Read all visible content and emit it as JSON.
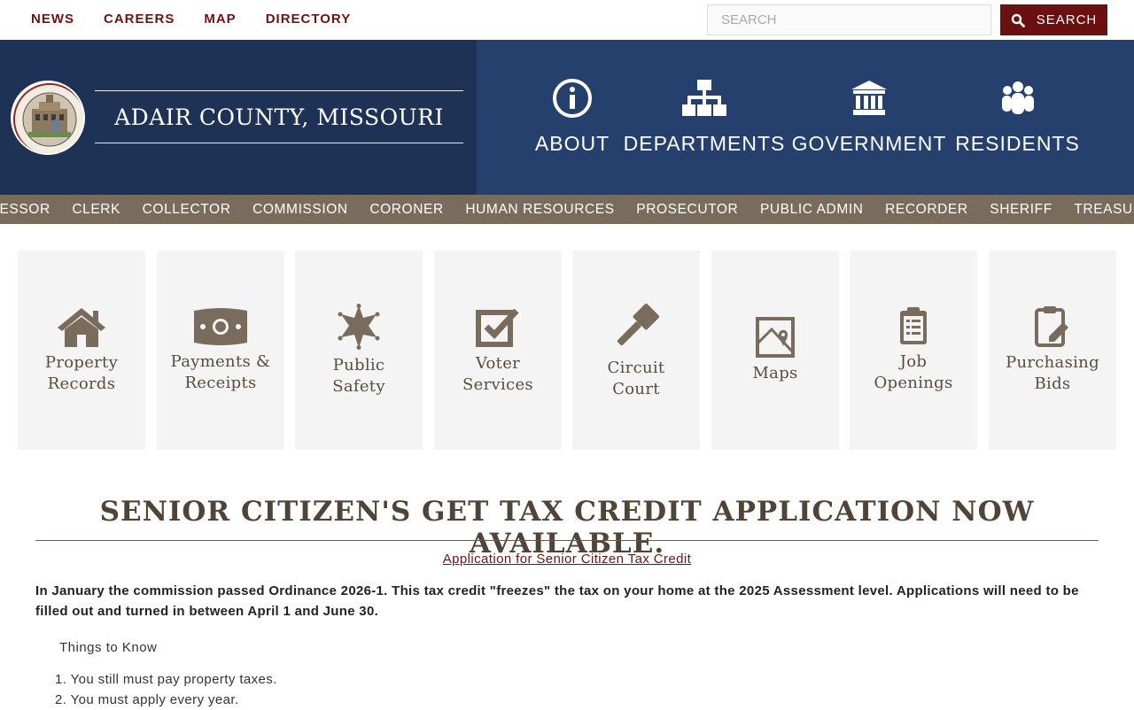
{
  "top_links": [
    "NEWS",
    "CAREERS",
    "MAP",
    "DIRECTORY"
  ],
  "search": {
    "placeholder": "SEARCH",
    "button_label": "SEARCH"
  },
  "site_title": "ADAIR COUNTY, MISSOURI",
  "main_nav": [
    {
      "label": "ABOUT",
      "icon": "info-icon"
    },
    {
      "label": "DEPARTMENTS",
      "icon": "org-chart-icon"
    },
    {
      "label": "GOVERNMENT",
      "icon": "building-columns-icon"
    },
    {
      "label": "RESIDENTS",
      "icon": "people-icon"
    }
  ],
  "departments": [
    "ASSESSOR",
    "CLERK",
    "COLLECTOR",
    "COMMISSION",
    "CORONER",
    "HUMAN RESOURCES",
    "PROSECUTOR",
    "PUBLIC ADMIN",
    "RECORDER",
    "SHERIFF",
    "TREASURER"
  ],
  "tiles": [
    {
      "line1": "Property",
      "line2": "Records",
      "icon": "house-icon"
    },
    {
      "line1": "Payments &",
      "line2": "Receipts",
      "icon": "money-bill-icon"
    },
    {
      "line1": "Public",
      "line2": "Safety",
      "icon": "sheriff-star-icon"
    },
    {
      "line1": "Voter",
      "line2": "Services",
      "icon": "checkbox-icon"
    },
    {
      "line1": "Circuit",
      "line2": "Court",
      "icon": "gavel-icon"
    },
    {
      "line1": "Maps",
      "line2": "",
      "icon": "map-icon"
    },
    {
      "line1": "Job",
      "line2": "Openings",
      "icon": "clipboard-list-icon"
    },
    {
      "line1": "Purchasing",
      "line2": "Bids",
      "icon": "clipboard-pen-icon"
    }
  ],
  "article": {
    "headline": "SENIOR CITIZEN'S GET TAX CREDIT APPLICATION NOW AVAILABLE.",
    "link_text": "Application for Senior Citizen Tax Credit",
    "intro_line1": "In January the commission passed Ordinance 2026-1.  This tax credit \"freezes\" the tax on your home at the 2025 Assessment level.  Applications will need to be",
    "intro_line2": "filled out and turned in between April 1 and June 30.",
    "things_heading": "Things to Know",
    "items": [
      "1. You still must pay property taxes.",
      "2. You must apply every year."
    ]
  },
  "colors": {
    "maroon": "#6b1010",
    "navy": "#1e3256",
    "navy_light": "#26406e",
    "taupe": "#7a6c5c"
  }
}
